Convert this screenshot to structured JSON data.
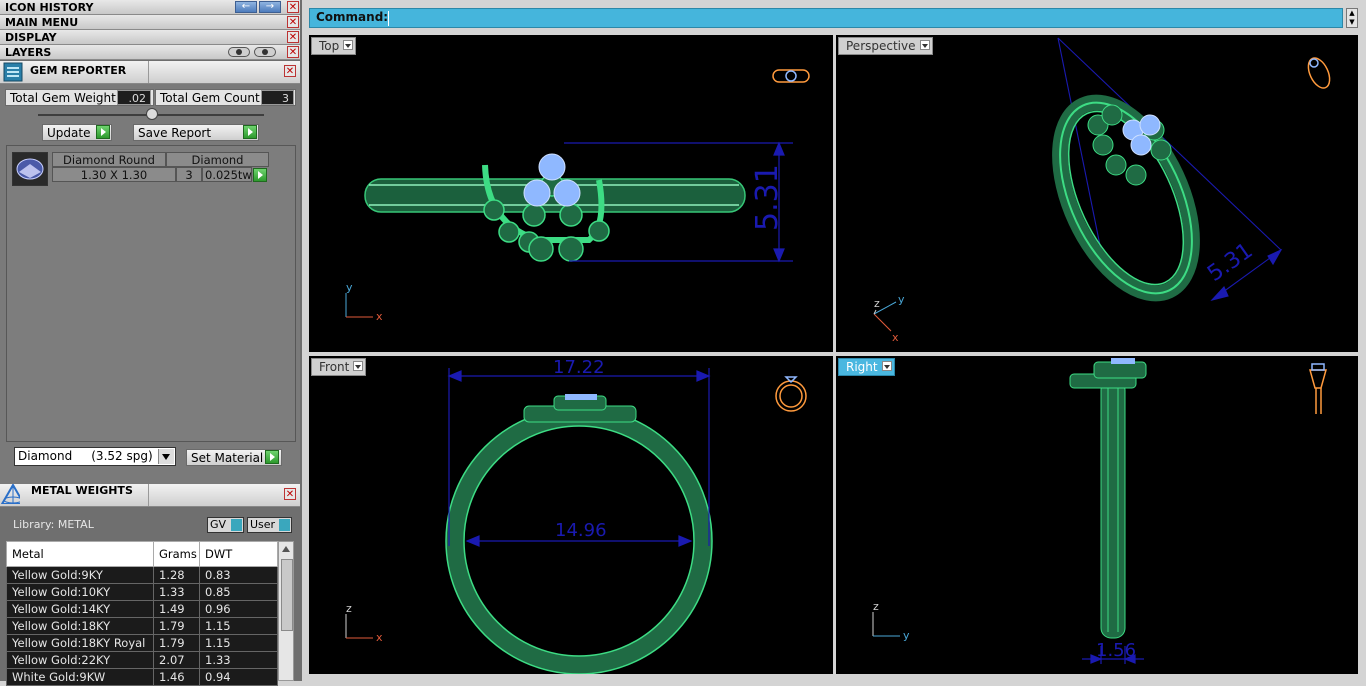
{
  "menus": {
    "icon_history": "ICON HISTORY",
    "main_menu": "MAIN MENU",
    "display": "DISPLAY",
    "layers": "LAYERS"
  },
  "gem_reporter": {
    "title": "GEM REPORTER",
    "total_weight_label": "Total Gem Weight",
    "total_weight_value": ".02",
    "total_count_label": "Total Gem Count",
    "total_count_value": "3",
    "update_button": "Update",
    "save_button": "Save Report",
    "gem": {
      "shape": "Diamond Round",
      "material": "Diamond",
      "size": "1.30 X 1.30",
      "count": "3",
      "weight": "0.025tw"
    },
    "material_select": "Diamond     (3.52 spg)",
    "set_material_button": "Set Material"
  },
  "metal_weights": {
    "title": "METAL WEIGHTS",
    "library_label": "Library: METAL",
    "gv_toggle": "GV",
    "user_toggle": "User",
    "columns": [
      "Metal",
      "Grams",
      "DWT"
    ],
    "rows": [
      [
        "Yellow Gold:9KY",
        "1.28",
        "0.83"
      ],
      [
        "Yellow Gold:10KY",
        "1.33",
        "0.85"
      ],
      [
        "Yellow Gold:14KY",
        "1.49",
        "0.96"
      ],
      [
        "Yellow Gold:18KY",
        "1.79",
        "1.15"
      ],
      [
        "Yellow Gold:18KY Royal",
        "1.79",
        "1.15"
      ],
      [
        "Yellow Gold:22KY",
        "2.07",
        "1.33"
      ],
      [
        "White Gold:9KW",
        "1.46",
        "0.94"
      ]
    ]
  },
  "command": {
    "label": "Command:",
    "value": ""
  },
  "viewports": {
    "top": {
      "label": "Top",
      "dimension": "5.31"
    },
    "perspective": {
      "label": "Perspective",
      "dimension": "5.31"
    },
    "front": {
      "label": "Front",
      "dimension_outer": "17.22",
      "dimension_inner": "14.96"
    },
    "right": {
      "label": "Right",
      "dimension": "1.56"
    }
  },
  "axes": {
    "x": "x",
    "y": "y",
    "z": "z"
  },
  "colors": {
    "ring": "#3ddc84",
    "gem": "#8fb8ff",
    "dimension": "#1a1ab0",
    "active_viewport": "#4ab7e0",
    "command_bar": "#45b5dc"
  }
}
